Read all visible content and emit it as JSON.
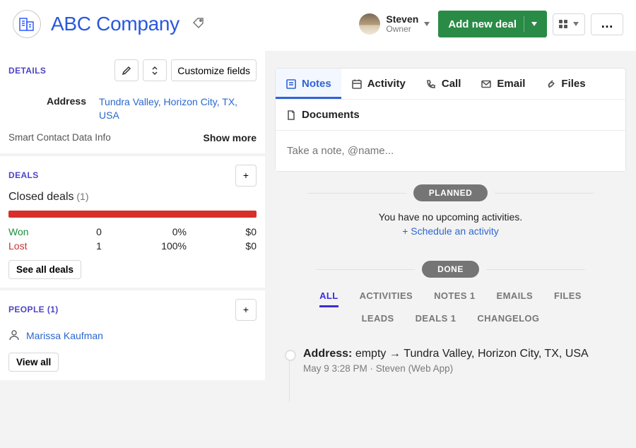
{
  "header": {
    "title": "ABC Company",
    "user": {
      "name": "Steven",
      "role": "Owner"
    },
    "primary_button": "Add new deal"
  },
  "details": {
    "section": "DETAILS",
    "customize": "Customize fields",
    "fields": [
      {
        "label": "Address",
        "value": "Tundra Valley, Horizon City, TX, USA"
      }
    ],
    "smart": "Smart Contact Data Info",
    "show_more": "Show more"
  },
  "deals": {
    "section": "DEALS",
    "closed": {
      "label": "Closed deals",
      "count_display": "(1)"
    },
    "won": {
      "label": "Won",
      "count": "0",
      "pct": "0%",
      "amount": "$0"
    },
    "lost": {
      "label": "Lost",
      "count": "1",
      "pct": "100%",
      "amount": "$0"
    },
    "see_all": "See all deals"
  },
  "people": {
    "section": "PEOPLE (1)",
    "person": "Marissa Kaufman",
    "view_all": "View all"
  },
  "tabs": {
    "notes": "Notes",
    "activity": "Activity",
    "call": "Call",
    "email": "Email",
    "files": "Files",
    "documents": "Documents",
    "note_placeholder": "Take a note, @name..."
  },
  "activities": {
    "planned": "PLANNED",
    "empty_text": "You have no upcoming activities.",
    "schedule": "+ Schedule an activity",
    "done": "DONE",
    "filter": {
      "all": "ALL",
      "activities": "ACTIVITIES",
      "notes": "NOTES",
      "notes_n": "1",
      "emails": "EMAILS",
      "files": "FILES",
      "leads": "LEADS",
      "deals": "DEALS",
      "deals_n": "1",
      "changelog": "CHANGELOG"
    },
    "entry": {
      "field": "Address:",
      "from": "empty",
      "arrow": "→",
      "to": "Tundra Valley, Horizon City, TX, USA",
      "sub": "May 9 3:28 PM   ·   Steven (Web App)"
    }
  }
}
